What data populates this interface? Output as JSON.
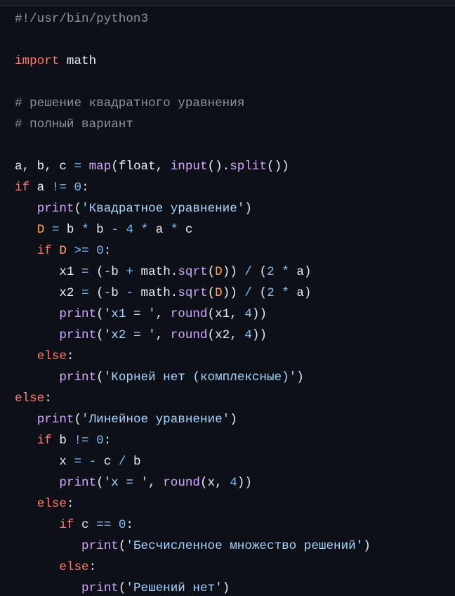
{
  "code_block": {
    "language": "python",
    "indent_unit": "   ",
    "colors": {
      "background": "#0d1117",
      "keyword": "#ff7b72",
      "builtin": "#d2a8ff",
      "string": "#a5d6ff",
      "number": "#79c0ff",
      "operator": "#79c0ff",
      "constant": "#ffa657",
      "comment": "#8b949e",
      "text": "#e6edf3"
    },
    "lines": [
      {
        "indent": 0,
        "tokens": [
          {
            "t": "com",
            "v": "#!/usr/bin/python3"
          }
        ]
      },
      {
        "indent": 0,
        "tokens": []
      },
      {
        "indent": 0,
        "tokens": [
          {
            "t": "kw",
            "v": "import"
          },
          {
            "t": "txt",
            "v": " math"
          }
        ]
      },
      {
        "indent": 0,
        "tokens": []
      },
      {
        "indent": 0,
        "tokens": [
          {
            "t": "com",
            "v": "# решение квадратного уравнения"
          }
        ]
      },
      {
        "indent": 0,
        "tokens": [
          {
            "t": "com",
            "v": "# полный вариант"
          }
        ]
      },
      {
        "indent": 0,
        "tokens": []
      },
      {
        "indent": 0,
        "tokens": [
          {
            "t": "txt",
            "v": "a, b, c "
          },
          {
            "t": "op",
            "v": "="
          },
          {
            "t": "txt",
            "v": " "
          },
          {
            "t": "fn",
            "v": "map"
          },
          {
            "t": "txt",
            "v": "(float, "
          },
          {
            "t": "fn",
            "v": "input"
          },
          {
            "t": "txt",
            "v": "()."
          },
          {
            "t": "fn",
            "v": "split"
          },
          {
            "t": "txt",
            "v": "())"
          }
        ]
      },
      {
        "indent": 0,
        "tokens": [
          {
            "t": "kw",
            "v": "if"
          },
          {
            "t": "txt",
            "v": " a "
          },
          {
            "t": "op",
            "v": "!="
          },
          {
            "t": "txt",
            "v": " "
          },
          {
            "t": "num",
            "v": "0"
          },
          {
            "t": "txt",
            "v": ":"
          }
        ]
      },
      {
        "indent": 1,
        "tokens": [
          {
            "t": "fn",
            "v": "print"
          },
          {
            "t": "txt",
            "v": "("
          },
          {
            "t": "str",
            "v": "'Квадратное уравнение'"
          },
          {
            "t": "txt",
            "v": ")"
          }
        ]
      },
      {
        "indent": 1,
        "tokens": [
          {
            "t": "const",
            "v": "D"
          },
          {
            "t": "txt",
            "v": " "
          },
          {
            "t": "op",
            "v": "="
          },
          {
            "t": "txt",
            "v": " b "
          },
          {
            "t": "op",
            "v": "*"
          },
          {
            "t": "txt",
            "v": " b "
          },
          {
            "t": "op",
            "v": "-"
          },
          {
            "t": "txt",
            "v": " "
          },
          {
            "t": "num",
            "v": "4"
          },
          {
            "t": "txt",
            "v": " "
          },
          {
            "t": "op",
            "v": "*"
          },
          {
            "t": "txt",
            "v": " a "
          },
          {
            "t": "op",
            "v": "*"
          },
          {
            "t": "txt",
            "v": " c"
          }
        ]
      },
      {
        "indent": 1,
        "tokens": [
          {
            "t": "kw",
            "v": "if"
          },
          {
            "t": "txt",
            "v": " "
          },
          {
            "t": "const",
            "v": "D"
          },
          {
            "t": "txt",
            "v": " "
          },
          {
            "t": "op",
            "v": ">="
          },
          {
            "t": "txt",
            "v": " "
          },
          {
            "t": "num",
            "v": "0"
          },
          {
            "t": "txt",
            "v": ":"
          }
        ]
      },
      {
        "indent": 2,
        "tokens": [
          {
            "t": "txt",
            "v": "x1 "
          },
          {
            "t": "op",
            "v": "="
          },
          {
            "t": "txt",
            "v": " ("
          },
          {
            "t": "op",
            "v": "-"
          },
          {
            "t": "txt",
            "v": "b "
          },
          {
            "t": "op",
            "v": "+"
          },
          {
            "t": "txt",
            "v": " math."
          },
          {
            "t": "fn",
            "v": "sqrt"
          },
          {
            "t": "txt",
            "v": "("
          },
          {
            "t": "const",
            "v": "D"
          },
          {
            "t": "txt",
            "v": ")) "
          },
          {
            "t": "op",
            "v": "/"
          },
          {
            "t": "txt",
            "v": " ("
          },
          {
            "t": "num",
            "v": "2"
          },
          {
            "t": "txt",
            "v": " "
          },
          {
            "t": "op",
            "v": "*"
          },
          {
            "t": "txt",
            "v": " a)"
          }
        ]
      },
      {
        "indent": 2,
        "tokens": [
          {
            "t": "txt",
            "v": "x2 "
          },
          {
            "t": "op",
            "v": "="
          },
          {
            "t": "txt",
            "v": " ("
          },
          {
            "t": "op",
            "v": "-"
          },
          {
            "t": "txt",
            "v": "b "
          },
          {
            "t": "op",
            "v": "-"
          },
          {
            "t": "txt",
            "v": " math."
          },
          {
            "t": "fn",
            "v": "sqrt"
          },
          {
            "t": "txt",
            "v": "("
          },
          {
            "t": "const",
            "v": "D"
          },
          {
            "t": "txt",
            "v": ")) "
          },
          {
            "t": "op",
            "v": "/"
          },
          {
            "t": "txt",
            "v": " ("
          },
          {
            "t": "num",
            "v": "2"
          },
          {
            "t": "txt",
            "v": " "
          },
          {
            "t": "op",
            "v": "*"
          },
          {
            "t": "txt",
            "v": " a)"
          }
        ]
      },
      {
        "indent": 2,
        "tokens": [
          {
            "t": "fn",
            "v": "print"
          },
          {
            "t": "txt",
            "v": "("
          },
          {
            "t": "str",
            "v": "'x1 = '"
          },
          {
            "t": "txt",
            "v": ", "
          },
          {
            "t": "fn",
            "v": "round"
          },
          {
            "t": "txt",
            "v": "(x1, "
          },
          {
            "t": "num",
            "v": "4"
          },
          {
            "t": "txt",
            "v": "))"
          }
        ]
      },
      {
        "indent": 2,
        "tokens": [
          {
            "t": "fn",
            "v": "print"
          },
          {
            "t": "txt",
            "v": "("
          },
          {
            "t": "str",
            "v": "'x2 = '"
          },
          {
            "t": "txt",
            "v": ", "
          },
          {
            "t": "fn",
            "v": "round"
          },
          {
            "t": "txt",
            "v": "(x2, "
          },
          {
            "t": "num",
            "v": "4"
          },
          {
            "t": "txt",
            "v": "))"
          }
        ]
      },
      {
        "indent": 1,
        "tokens": [
          {
            "t": "kw",
            "v": "else"
          },
          {
            "t": "txt",
            "v": ":"
          }
        ]
      },
      {
        "indent": 2,
        "tokens": [
          {
            "t": "fn",
            "v": "print"
          },
          {
            "t": "txt",
            "v": "("
          },
          {
            "t": "str",
            "v": "'Корней нет (комплексные)'"
          },
          {
            "t": "txt",
            "v": ")"
          }
        ]
      },
      {
        "indent": 0,
        "tokens": [
          {
            "t": "kw",
            "v": "else"
          },
          {
            "t": "txt",
            "v": ":"
          }
        ]
      },
      {
        "indent": 1,
        "tokens": [
          {
            "t": "fn",
            "v": "print"
          },
          {
            "t": "txt",
            "v": "("
          },
          {
            "t": "str",
            "v": "'Линейное уравнение'"
          },
          {
            "t": "txt",
            "v": ")"
          }
        ]
      },
      {
        "indent": 1,
        "tokens": [
          {
            "t": "kw",
            "v": "if"
          },
          {
            "t": "txt",
            "v": " b "
          },
          {
            "t": "op",
            "v": "!="
          },
          {
            "t": "txt",
            "v": " "
          },
          {
            "t": "num",
            "v": "0"
          },
          {
            "t": "txt",
            "v": ":"
          }
        ]
      },
      {
        "indent": 2,
        "tokens": [
          {
            "t": "txt",
            "v": "x "
          },
          {
            "t": "op",
            "v": "="
          },
          {
            "t": "txt",
            "v": " "
          },
          {
            "t": "op",
            "v": "-"
          },
          {
            "t": "txt",
            "v": " c "
          },
          {
            "t": "op",
            "v": "/"
          },
          {
            "t": "txt",
            "v": " b"
          }
        ]
      },
      {
        "indent": 2,
        "tokens": [
          {
            "t": "fn",
            "v": "print"
          },
          {
            "t": "txt",
            "v": "("
          },
          {
            "t": "str",
            "v": "'x = '"
          },
          {
            "t": "txt",
            "v": ", "
          },
          {
            "t": "fn",
            "v": "round"
          },
          {
            "t": "txt",
            "v": "(x, "
          },
          {
            "t": "num",
            "v": "4"
          },
          {
            "t": "txt",
            "v": "))"
          }
        ]
      },
      {
        "indent": 1,
        "tokens": [
          {
            "t": "kw",
            "v": "else"
          },
          {
            "t": "txt",
            "v": ":"
          }
        ]
      },
      {
        "indent": 2,
        "tokens": [
          {
            "t": "kw",
            "v": "if"
          },
          {
            "t": "txt",
            "v": " c "
          },
          {
            "t": "op",
            "v": "=="
          },
          {
            "t": "txt",
            "v": " "
          },
          {
            "t": "num",
            "v": "0"
          },
          {
            "t": "txt",
            "v": ":"
          }
        ]
      },
      {
        "indent": 3,
        "tokens": [
          {
            "t": "fn",
            "v": "print"
          },
          {
            "t": "txt",
            "v": "("
          },
          {
            "t": "str",
            "v": "'Бесчисленное множество решений'"
          },
          {
            "t": "txt",
            "v": ")"
          }
        ]
      },
      {
        "indent": 2,
        "tokens": [
          {
            "t": "kw",
            "v": "else"
          },
          {
            "t": "txt",
            "v": ":"
          }
        ]
      },
      {
        "indent": 3,
        "tokens": [
          {
            "t": "fn",
            "v": "print"
          },
          {
            "t": "txt",
            "v": "("
          },
          {
            "t": "str",
            "v": "'Решений нет'"
          },
          {
            "t": "txt",
            "v": ")"
          }
        ]
      }
    ]
  }
}
